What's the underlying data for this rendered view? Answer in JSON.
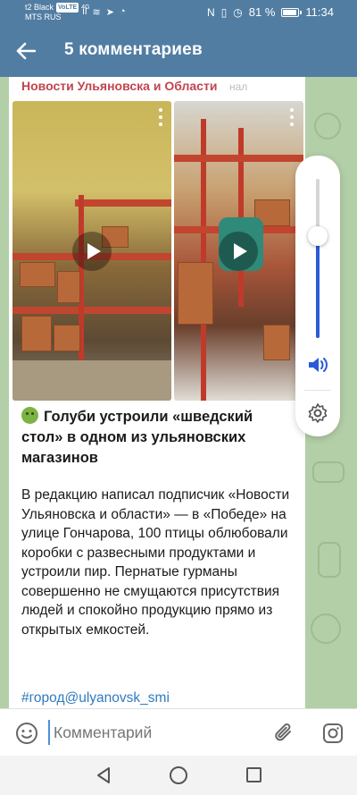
{
  "status_bar": {
    "carrier_line1": "t2 Black",
    "carrier_badge": "VoLTE",
    "carrier_line2": "MTS RUS",
    "network": "4G",
    "battery_percent": "81 %",
    "battery_level": 0.81,
    "time": "11:34",
    "icons": [
      "wifi-icon",
      "signal-icon",
      "telegram-icon",
      "whatsapp-icon",
      "nfc-icon",
      "vibrate-icon",
      "alarm-icon"
    ]
  },
  "header": {
    "back_icon": "arrow-left-icon",
    "title": "5 комментариев"
  },
  "post": {
    "channel_name": "Новости Ульяновска и Области",
    "channel_name_overflow": "нал",
    "videos": [
      {
        "play_icon": "play-icon",
        "menu_icon": "more-vertical-icon"
      },
      {
        "play_icon": "play-icon",
        "menu_icon": "more-vertical-icon"
      }
    ],
    "headline": "Голуби устроили «шведский стол» в одном из ульяновских магазинов",
    "headline_emoji": "nauseated-face",
    "body": "В редакцию написал подписчик «Новости Ульяновска и области» — в «Победе» на улице Гончарова, 100 птицы облюбовали коробки с развесными продуктами и устроили пир. Пернатые гурманы совершенно не смущаются присутствия людей и спокойно продукцию прямо из открытых емкостей.",
    "hashtag": "#город@ulyanovsk_smi"
  },
  "volume_panel": {
    "level": 0.64,
    "speaker_icon": "volume-icon",
    "settings_icon": "gear-icon",
    "accent_color": "#2a5bd7"
  },
  "input_bar": {
    "placeholder": "Комментарий",
    "emoji_icon": "smile-icon",
    "attach_icon": "paperclip-icon",
    "camera_icon": "instagram-camera-icon"
  },
  "nav_bar": {
    "back_icon": "triangle-back-icon",
    "home_icon": "circle-home-icon",
    "recent_icon": "square-recents-icon"
  },
  "colors": {
    "header": "#517da2",
    "channel_name": "#c0464f",
    "link": "#2f7bbf"
  }
}
